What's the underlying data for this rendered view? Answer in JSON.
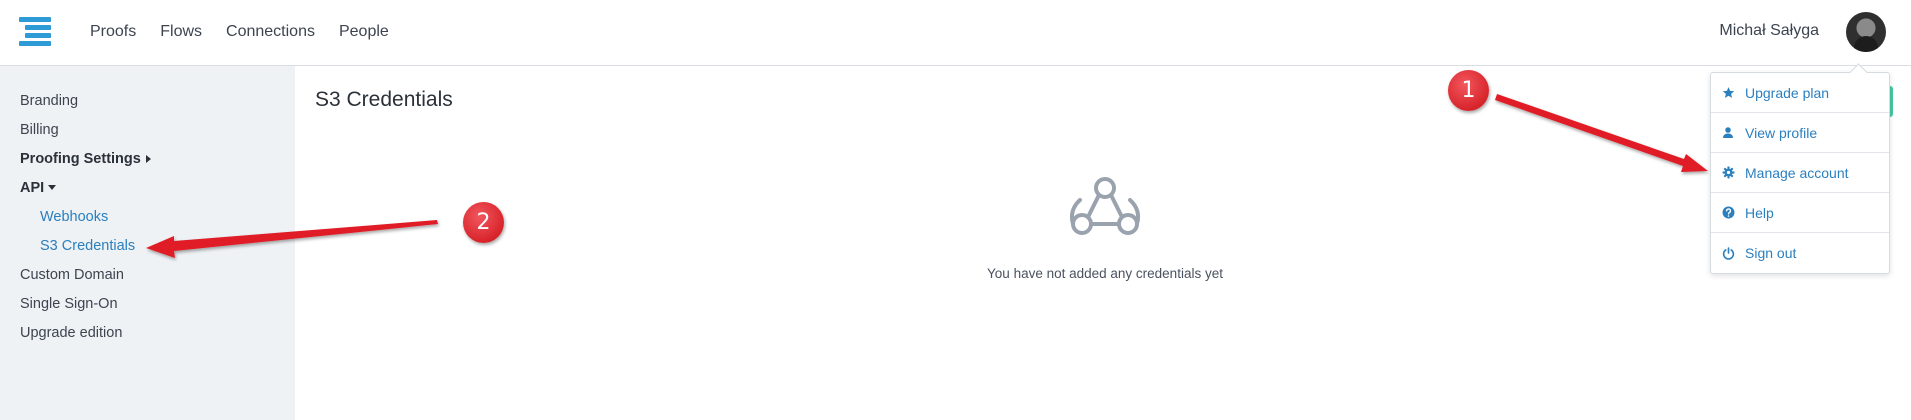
{
  "header": {
    "nav": [
      "Proofs",
      "Flows",
      "Connections",
      "People"
    ],
    "user_name": "Michał Sałyga"
  },
  "sidebar": {
    "items": [
      {
        "label": "Branding"
      },
      {
        "label": "Billing"
      },
      {
        "label": "Proofing Settings"
      },
      {
        "label": "API"
      },
      {
        "label": "Webhooks"
      },
      {
        "label": "S3 Credentials"
      },
      {
        "label": "Custom Domain"
      },
      {
        "label": "Single Sign-On"
      },
      {
        "label": "Upgrade edition"
      }
    ]
  },
  "main": {
    "title": "S3 Credentials",
    "empty_message": "You have not added any credentials yet"
  },
  "user_menu": {
    "items": [
      {
        "label": "Upgrade plan",
        "icon": "star-icon"
      },
      {
        "label": "View profile",
        "icon": "user-icon"
      },
      {
        "label": "Manage account",
        "icon": "gear-icon"
      },
      {
        "label": "Help",
        "icon": "question-icon"
      },
      {
        "label": "Sign out",
        "icon": "power-icon"
      }
    ]
  },
  "annotations": {
    "badge_1": "1",
    "badge_2": "2"
  },
  "colors": {
    "accent": "#2a7fbf",
    "logo": "#2f9bd6",
    "annotation": "#e01f26",
    "green_tab": "#46c7a2"
  }
}
